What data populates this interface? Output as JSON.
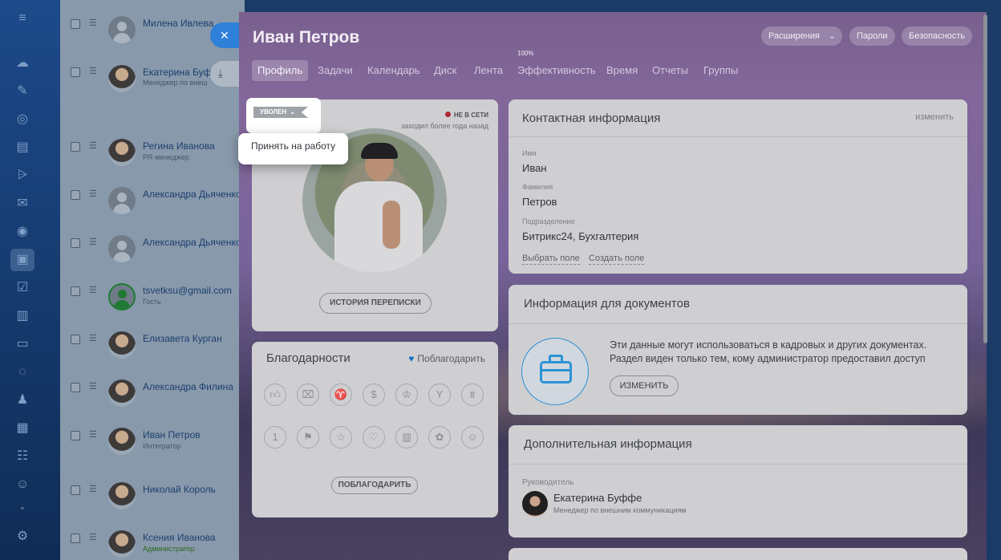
{
  "sidebar_icons": [
    "menu-icon",
    "pulse-icon",
    "tasks-icon",
    "crm-icon",
    "doc-icon",
    "filter-icon",
    "mail-icon",
    "target-icon",
    "employees-icon",
    "check-icon",
    "file-icon",
    "storage-icon",
    "chat-icon",
    "robot-icon",
    "calendar-icon",
    "planner-icon",
    "group-icon",
    "collapse-icon",
    "settings-icon"
  ],
  "list": [
    {
      "name": "Милена Ивлева",
      "sub": "",
      "avatar": "placeholder"
    },
    {
      "name": "Екатерина Буфф",
      "sub": "Менеджер по внеш",
      "avatar": "photo"
    },
    {
      "name": "Регина Иванова",
      "sub": "PR-менеджер",
      "avatar": "photo"
    },
    {
      "name": "Александра Дьяченко",
      "sub": "",
      "avatar": "placeholder"
    },
    {
      "name": "Александра Дьяченко",
      "sub": "",
      "avatar": "placeholder"
    },
    {
      "name": "tsvetksu@gmail.com",
      "sub": "Гость",
      "avatar": "guest"
    },
    {
      "name": "Елизавета Курган",
      "sub": "",
      "avatar": "photo"
    },
    {
      "name": "Александра Филина",
      "sub": "",
      "avatar": "photo"
    },
    {
      "name": "Иван Петров",
      "sub": "Интегратор",
      "avatar": "photo"
    },
    {
      "name": "Николай Король",
      "sub": "",
      "avatar": "photo"
    },
    {
      "name": "Ксения Иванова",
      "sub": "Администратор",
      "avatar": "photo"
    }
  ],
  "panel": {
    "title": "Иван Петров",
    "buttons": {
      "extensions": "Расширения",
      "passwords": "Пароли",
      "security": "Безопасность"
    },
    "tabs": [
      {
        "label": "Профиль"
      },
      {
        "label": "Задачи"
      },
      {
        "label": "Календарь"
      },
      {
        "label": "Диск"
      },
      {
        "label": "Лента"
      },
      {
        "label": "Эффективность",
        "sup": "100%"
      },
      {
        "label": "Время"
      },
      {
        "label": "Отчеты"
      },
      {
        "label": "Группы"
      }
    ],
    "profile": {
      "status_badge": "УВОЛЕН",
      "online_status": "НЕ В СЕТИ",
      "last_seen": "заходил более года назад",
      "history_button": "ИСТОРИЯ ПЕРЕПИСКИ",
      "popup_item": "Принять на работу"
    },
    "thanks": {
      "title": "Благодарности",
      "thank_link": "Поблагодарить",
      "thank_button": "ПОБЛАГОДАРИТЬ",
      "icons": [
        "thumbs-up-icon",
        "gift-icon",
        "cup-icon",
        "money-bag-icon",
        "crown-icon",
        "cocktail-icon",
        "cake-icon",
        "one-icon",
        "flag-icon",
        "star-icon",
        "heart-icon",
        "beer-icon",
        "flower-icon",
        "smile-icon"
      ]
    },
    "contact": {
      "title": "Контактная информация",
      "edit": "изменить",
      "fields": [
        {
          "label": "Имя",
          "value": "Иван"
        },
        {
          "label": "Фамилия",
          "value": "Петров"
        },
        {
          "label": "Подразделение",
          "value": "Битрикс24, Бухгалтерия"
        }
      ],
      "select_field": "Выбрать поле",
      "create_field": "Создать поле"
    },
    "documents": {
      "title": "Информация для документов",
      "text": "Эти данные могут использоваться в кадровых и других документах. Раздел виден только тем, кому администратор предоставил доступ",
      "button": "ИЗМЕНИТЬ"
    },
    "additional": {
      "title": "Дополнительная информация",
      "manager_label": "Руководитель",
      "manager_name": "Екатерина Буффе",
      "manager_position": "Менеджер по внешним коммуникациям"
    }
  }
}
